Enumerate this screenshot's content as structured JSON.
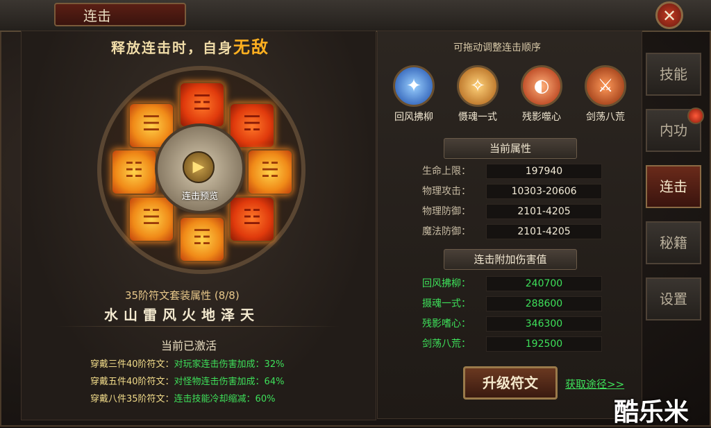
{
  "window": {
    "title": "连击",
    "close_icon": "✕"
  },
  "left": {
    "slogan_prefix": "释放连击时，自身",
    "slogan_highlight": "无敌",
    "preview_label": "连击预览",
    "set_title": "35阶符文套装属性 (8/8)",
    "elements": "水山雷风火地泽天",
    "active_title": "当前已激活",
    "bonuses": [
      {
        "cond": "穿戴三件40阶符文：",
        "effect": "对玩家连击伤害加成：32%"
      },
      {
        "cond": "穿戴五件40阶符文：",
        "effect": "对怪物连击伤害加成：64%"
      },
      {
        "cond": "穿戴八件35阶符文：",
        "effect": "连击技能冷却缩减：60%"
      }
    ]
  },
  "right": {
    "drag_hint": "可拖动调整连击顺序",
    "skills": [
      {
        "name": "回风拂柳",
        "icon": "wind-skill-icon",
        "color": "#2a6ad8"
      },
      {
        "name": "慑魂一式",
        "icon": "soul-skill-icon",
        "color": "#d88a1a"
      },
      {
        "name": "残影噬心",
        "icon": "shadow-skill-icon",
        "color": "#d83a1a"
      },
      {
        "name": "剑荡八荒",
        "icon": "sword-skill-icon",
        "color": "#c8401a"
      }
    ],
    "attr_head": "当前属性",
    "attrs": [
      {
        "label": "生命上限：",
        "value": "197940"
      },
      {
        "label": "物理攻击：",
        "value": "10303-20606"
      },
      {
        "label": "物理防御：",
        "value": "2101-4205"
      },
      {
        "label": "魔法防御：",
        "value": "2101-4205"
      }
    ],
    "dmg_head": "连击附加伤害值",
    "dmg": [
      {
        "label": "回风拂柳：",
        "value": "240700"
      },
      {
        "label": "摄魂一式：",
        "value": "288600"
      },
      {
        "label": "残影嗜心：",
        "value": "346300"
      },
      {
        "label": "剑荡八荒：",
        "value": "192500"
      }
    ],
    "upgrade": "升级符文",
    "get_link": "获取途径>>"
  },
  "side_tabs": [
    "技能",
    "内功",
    "连击",
    "秘籍",
    "设置"
  ],
  "watermark": "酷乐米"
}
